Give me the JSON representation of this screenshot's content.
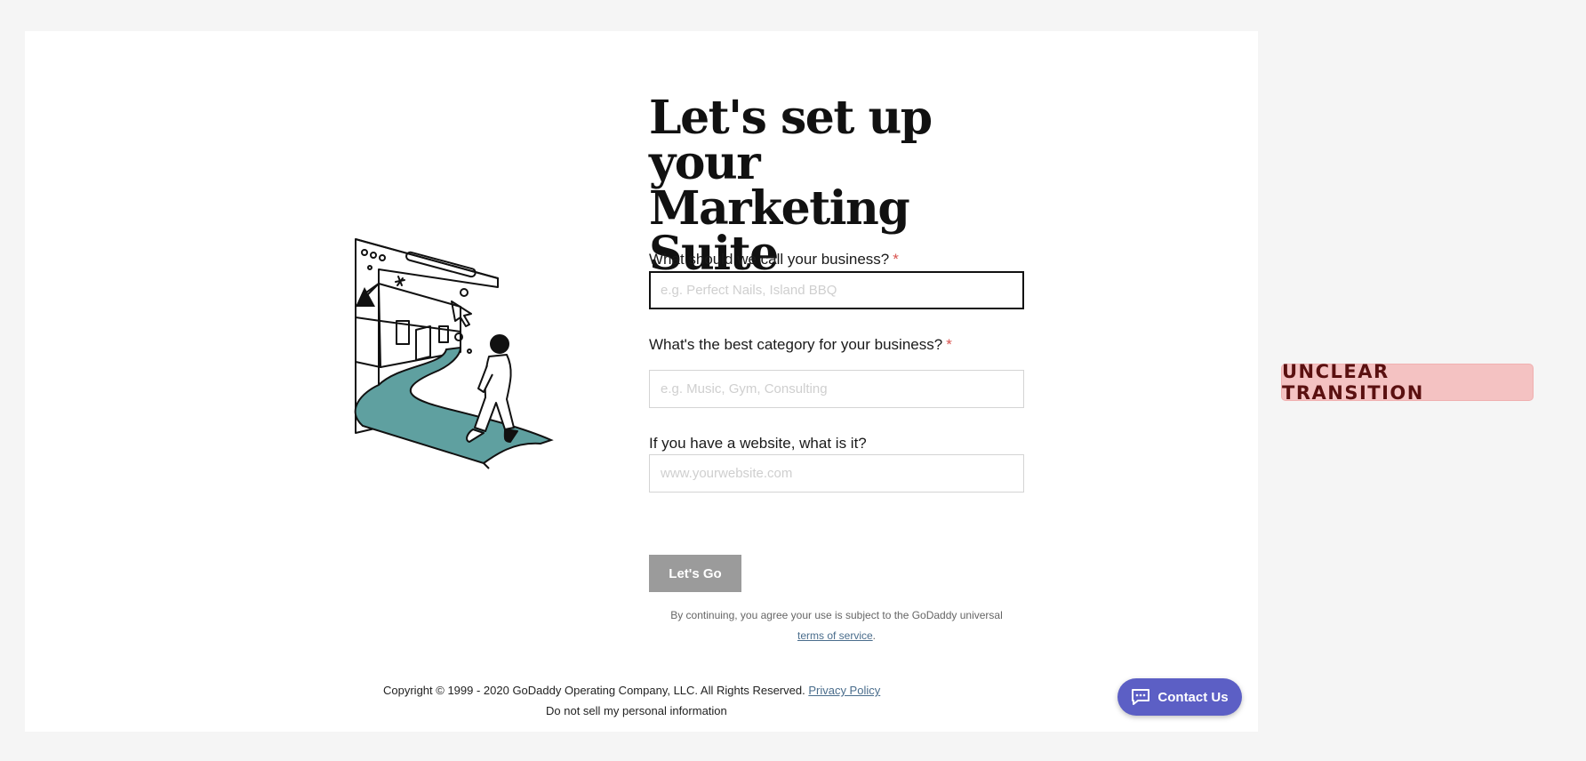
{
  "form": {
    "title": "Let's set up your Marketing Suite",
    "business_name": {
      "label": "What should we call your business?",
      "required_mark": "*",
      "placeholder": "e.g. Perfect Nails, Island BBQ",
      "value": ""
    },
    "category": {
      "label": "What's the best category for your business?",
      "required_mark": "*",
      "placeholder": "e.g. Music, Gym, Consulting",
      "value": ""
    },
    "website": {
      "label": "If you have a website, what is it?",
      "placeholder": "www.yourwebsite.com",
      "value": ""
    },
    "submit_label": "Let's Go",
    "legal_text": "By continuing, you agree your use is subject to the GoDaddy universal",
    "legal_link": "terms of service",
    "legal_end": "."
  },
  "footer": {
    "copyright": "Copyright © 1999 - 2020 GoDaddy Operating Company, LLC. All Rights Reserved.",
    "privacy_link": "Privacy Policy",
    "do_not_sell": "Do not sell my personal information"
  },
  "contact": {
    "label": "Contact Us",
    "icon": "chat-icon"
  },
  "badge": {
    "label": "UNCLEAR TRANSITION"
  },
  "colors": {
    "button_disabled": "#9b9b9b",
    "contact_button": "#5c5fc5",
    "path_teal": "#5fa0a0",
    "required_star": "#d9534f",
    "badge_bg": "#f4c2c2"
  }
}
